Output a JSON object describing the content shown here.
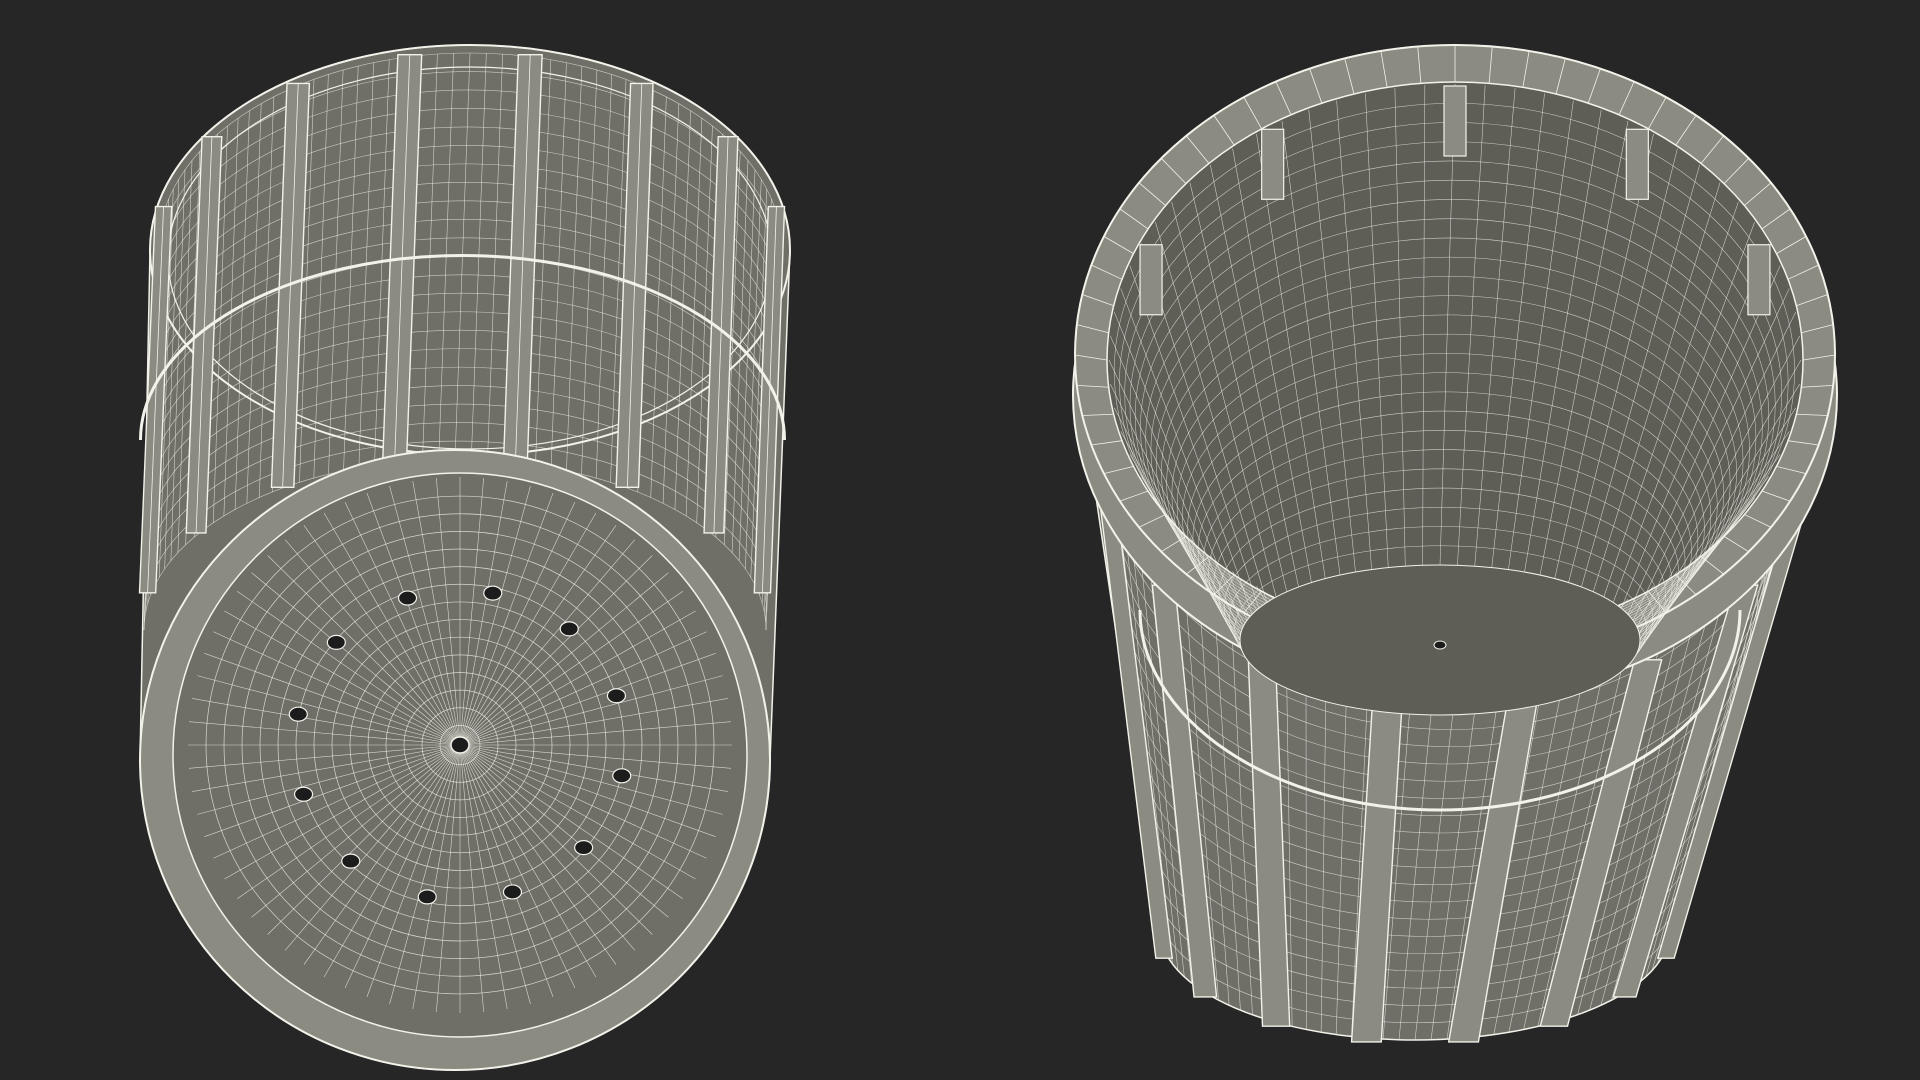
{
  "scene": {
    "background": "#262626",
    "surface_color": "#8b8b82",
    "surface_dark": "#6f6f68",
    "interior_color": "#5e5e57",
    "wire_color": "#f2f2ea",
    "hole_color": "#1c1c1c"
  },
  "views": [
    {
      "name": "bottom-view",
      "subject": "wireframe-basket",
      "bottom_holes": 12,
      "ribs": 8
    },
    {
      "name": "top-view",
      "subject": "wireframe-basket",
      "ribs": 8
    }
  ]
}
